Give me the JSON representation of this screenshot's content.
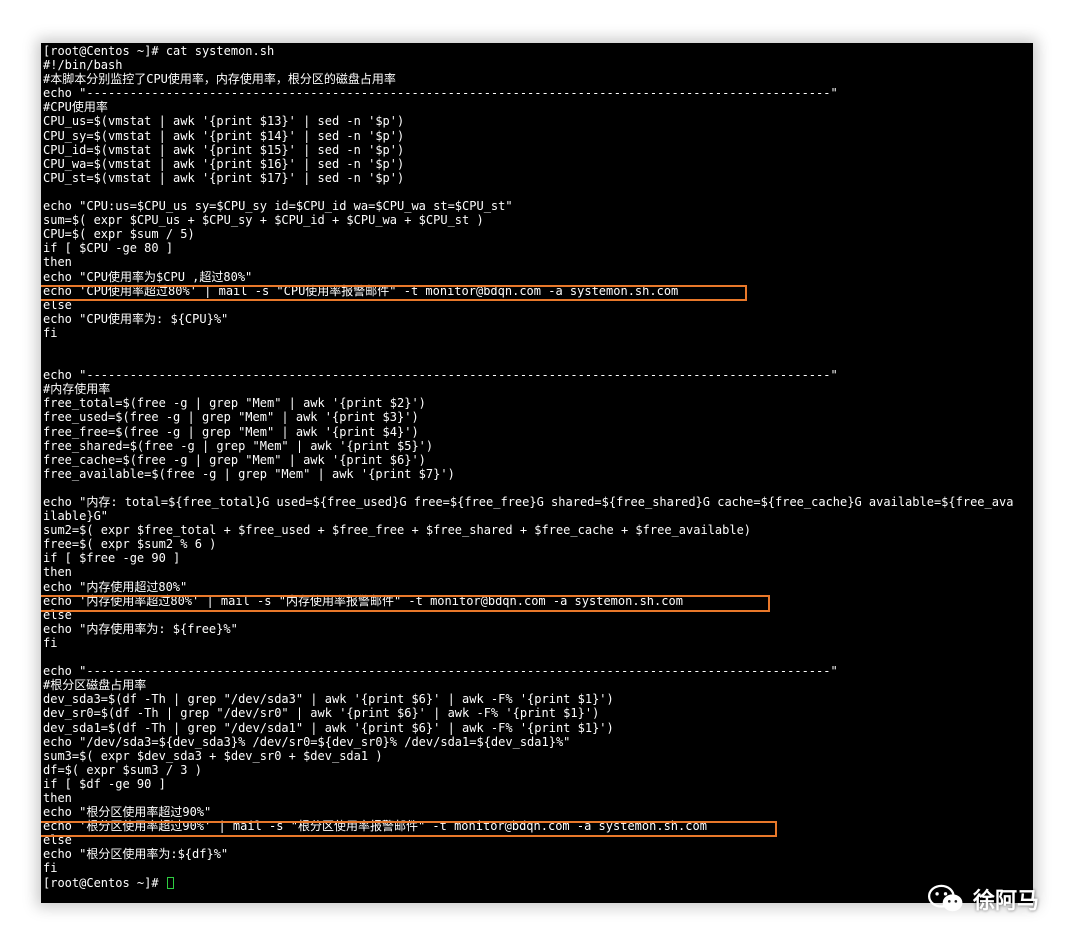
{
  "terminal": {
    "lines": [
      "[root@Centos ~]# cat systemon.sh",
      "#!/bin/bash",
      "#本脚本分别监控了CPU使用率，内存使用率，根分区的磁盘占用率",
      "echo \"-------------------------------------------------------------------------------------------------------\"",
      "#CPU使用率",
      "CPU_us=$(vmstat | awk '{print $13}' | sed -n '$p')",
      "CPU_sy=$(vmstat | awk '{print $14}' | sed -n '$p')",
      "CPU_id=$(vmstat | awk '{print $15}' | sed -n '$p')",
      "CPU_wa=$(vmstat | awk '{print $16}' | sed -n '$p')",
      "CPU_st=$(vmstat | awk '{print $17}' | sed -n '$p')",
      "",
      "echo \"CPU:us=$CPU_us sy=$CPU_sy id=$CPU_id wa=$CPU_wa st=$CPU_st\"",
      "sum=$( expr $CPU_us + $CPU_sy + $CPU_id + $CPU_wa + $CPU_st )",
      "CPU=$( expr $sum / 5)",
      "if [ $CPU -ge 80 ]",
      "then",
      "echo \"CPU使用率为$CPU ,超过80%\"",
      "echo 'CPU使用率超过80%' | mail -s \"CPU使用率报警邮件\" -t monitor@bdqn.com -a systemon.sh.com",
      "else",
      "echo \"CPU使用率为: ${CPU}%\"",
      "fi",
      "",
      "",
      "echo \"-------------------------------------------------------------------------------------------------------\"",
      "#内存使用率",
      "free_total=$(free -g | grep \"Mem\" | awk '{print $2}')",
      "free_used=$(free -g | grep \"Mem\" | awk '{print $3}')",
      "free_free=$(free -g | grep \"Mem\" | awk '{print $4}')",
      "free_shared=$(free -g | grep \"Mem\" | awk '{print $5}')",
      "free_cache=$(free -g | grep \"Mem\" | awk '{print $6}')",
      "free_available=$(free -g | grep \"Mem\" | awk '{print $7}')",
      "",
      "echo \"内存: total=${free_total}G used=${free_used}G free=${free_free}G shared=${free_shared}G cache=${free_cache}G available=${free_ava",
      "ilable}G\"",
      "sum2=$( expr $free_total + $free_used + $free_free + $free_shared + $free_cache + $free_available)",
      "free=$( expr $sum2 % 6 )",
      "if [ $free -ge 90 ]",
      "then",
      "echo \"内存使用超过80%\"",
      "echo '内存使用率超过80%' | mail -s \"内存使用率报警邮件\" -t monitor@bdqn.com -a systemon.sh.com",
      "else",
      "echo \"内存使用率为: ${free}%\"",
      "fi",
      "",
      "echo \"-------------------------------------------------------------------------------------------------------\"",
      "#根分区磁盘占用率",
      "dev_sda3=$(df -Th | grep \"/dev/sda3\" | awk '{print $6}' | awk -F% '{print $1}')",
      "dev_sr0=$(df -Th | grep \"/dev/sr0\" | awk '{print $6}' | awk -F% '{print $1}')",
      "dev_sda1=$(df -Th | grep \"/dev/sda1\" | awk '{print $6}' | awk -F% '{print $1}')",
      "echo \"/dev/sda3=${dev_sda3}% /dev/sr0=${dev_sr0}% /dev/sda1=${dev_sda1}%\"",
      "sum3=$( expr $dev_sda3 + $dev_sr0 + $dev_sda1 )",
      "df=$( expr $sum3 / 3 )",
      "if [ $df -ge 90 ]",
      "then",
      "echo \"根分区使用率超过90%\"",
      "echo '根分区使用率超过90%' | mail -s \"根分区使用率报警邮件\" -t monitor@bdqn.com -a systemon.sh.com",
      "else",
      "echo \"根分区使用率为:${df}%\"",
      "fi",
      "[root@Centos ~]# "
    ]
  },
  "highlight_color": "#e8782a",
  "cursor_color": "#2ecc40",
  "watermark": {
    "icon": "wechat-icon",
    "text": "徐阿马"
  }
}
